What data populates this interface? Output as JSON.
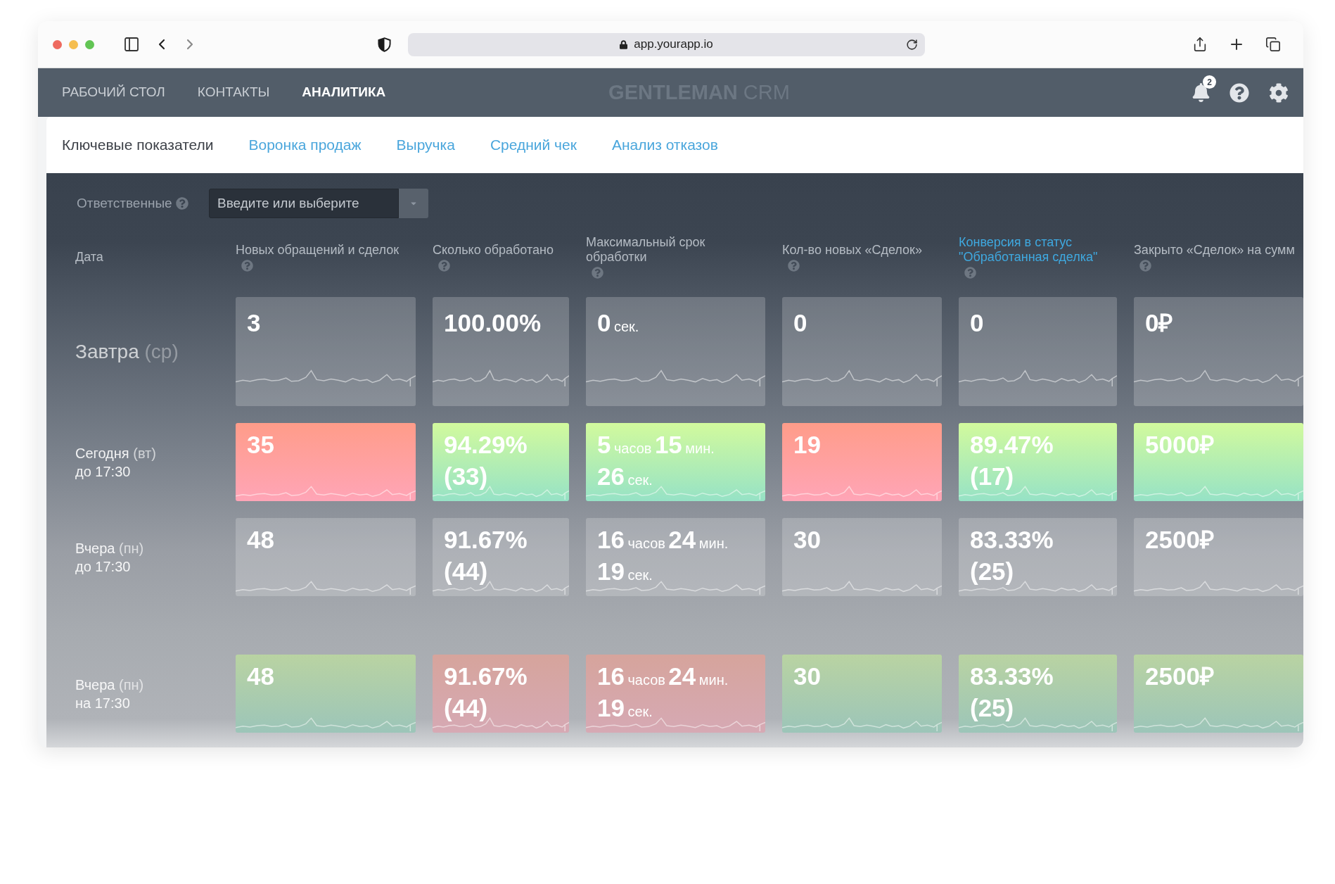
{
  "browser": {
    "url": "app.yourapp.io"
  },
  "nav": {
    "items": [
      {
        "label": "РАБОЧИЙ СТОЛ",
        "selected": false
      },
      {
        "label": "КОНТАКТЫ",
        "selected": false
      },
      {
        "label": "АНАЛИТИКА",
        "selected": true
      }
    ],
    "logo": {
      "name": "GENTLEMAN",
      "suffix": "CRM"
    },
    "notifications": {
      "badge": "2"
    }
  },
  "tabs": [
    {
      "label": "Ключевые показатели",
      "selected": true
    },
    {
      "label": "Воронка продаж",
      "selected": false
    },
    {
      "label": "Выручка",
      "selected": false
    },
    {
      "label": "Средний чек",
      "selected": false
    },
    {
      "label": "Анализ отказов",
      "selected": false
    }
  ],
  "filter": {
    "label": "Ответственные",
    "placeholder": "Введите или выберите"
  },
  "table": {
    "date_header": "Дата",
    "columns": [
      {
        "lines": [
          "Новых обращений и сделок"
        ],
        "highlighted": false
      },
      {
        "lines": [
          "Сколько обработано"
        ],
        "highlighted": false
      },
      {
        "lines": [
          "Максимальный срок",
          "обработки"
        ],
        "highlighted": false
      },
      {
        "lines": [
          "Кол-во новых «Сделок»"
        ],
        "highlighted": false
      },
      {
        "lines": [
          "Конверсия в статус",
          "\"Обработанная сделка\""
        ],
        "highlighted": true
      },
      {
        "lines": [
          "Закрыто «Сделок» на сумм"
        ],
        "highlighted": false
      }
    ],
    "rows": [
      {
        "kind": "headline",
        "faded": false,
        "day": "Завтра",
        "weekday": "(ср)",
        "cells": [
          {
            "kind": "neutral",
            "lines": [
              [
                {
                  "number": "3"
                }
              ]
            ]
          },
          {
            "kind": "neutral",
            "lines": [
              [
                {
                  "number": "100.00%"
                }
              ]
            ]
          },
          {
            "kind": "neutral",
            "lines": [
              [
                {
                  "number": "0",
                  "unit": "сек."
                }
              ]
            ]
          },
          {
            "kind": "neutral",
            "lines": [
              [
                {
                  "number": "0"
                }
              ]
            ]
          },
          {
            "kind": "neutral",
            "lines": [
              [
                {
                  "number": "0"
                }
              ]
            ]
          },
          {
            "kind": "neutral",
            "lines": [
              [
                {
                  "number": "0₽"
                }
              ]
            ]
          }
        ]
      },
      {
        "kind": "period",
        "faded": false,
        "day": "Сегодня",
        "weekday": "(вт)",
        "time": "до 17:30",
        "cells": [
          {
            "kind": "bad",
            "lines": [
              [
                {
                  "number": "35"
                }
              ]
            ]
          },
          {
            "kind": "good",
            "lines": [
              [
                {
                  "number": "94.29%"
                }
              ],
              [
                {
                  "number": "(33)"
                }
              ]
            ]
          },
          {
            "kind": "good",
            "lines": [
              [
                {
                  "number": "5",
                  "unit": "часов"
                },
                {
                  "number": "15",
                  "unit": "мин."
                }
              ],
              [
                {
                  "number": "26",
                  "unit": "сек."
                }
              ]
            ]
          },
          {
            "kind": "bad",
            "lines": [
              [
                {
                  "number": "19"
                }
              ]
            ]
          },
          {
            "kind": "good",
            "lines": [
              [
                {
                  "number": "89.47%"
                }
              ],
              [
                {
                  "number": "(17)"
                }
              ]
            ]
          },
          {
            "kind": "good",
            "lines": [
              [
                {
                  "number": "5000₽"
                }
              ]
            ]
          }
        ]
      },
      {
        "kind": "period",
        "faded": false,
        "day": "Вчера",
        "weekday": "(пн)",
        "time": "до 17:30",
        "cells": [
          {
            "kind": "neutral",
            "lines": [
              [
                {
                  "number": "48"
                }
              ]
            ]
          },
          {
            "kind": "neutral",
            "lines": [
              [
                {
                  "number": "91.67%"
                }
              ],
              [
                {
                  "number": "(44)"
                }
              ]
            ]
          },
          {
            "kind": "neutral",
            "lines": [
              [
                {
                  "number": "16",
                  "unit": "часов"
                },
                {
                  "number": "24",
                  "unit": "мин."
                }
              ],
              [
                {
                  "number": "19",
                  "unit": "сек."
                }
              ]
            ]
          },
          {
            "kind": "neutral",
            "lines": [
              [
                {
                  "number": "30"
                }
              ]
            ]
          },
          {
            "kind": "neutral",
            "lines": [
              [
                {
                  "number": "83.33%"
                }
              ],
              [
                {
                  "number": "(25)"
                }
              ]
            ]
          },
          {
            "kind": "neutral",
            "lines": [
              [
                {
                  "number": "2500₽"
                }
              ]
            ]
          }
        ]
      },
      {
        "kind": "period",
        "faded": true,
        "day": "Вчера",
        "weekday": "(пн)",
        "time": "на 17:30",
        "cells": [
          {
            "kind": "good",
            "lines": [
              [
                {
                  "number": "48"
                }
              ]
            ]
          },
          {
            "kind": "bad",
            "lines": [
              [
                {
                  "number": "91.67%"
                }
              ],
              [
                {
                  "number": "(44)"
                }
              ]
            ]
          },
          {
            "kind": "bad",
            "lines": [
              [
                {
                  "number": "16",
                  "unit": "часов"
                },
                {
                  "number": "24",
                  "unit": "мин."
                }
              ],
              [
                {
                  "number": "19",
                  "unit": "сек."
                }
              ]
            ]
          },
          {
            "kind": "good",
            "lines": [
              [
                {
                  "number": "30"
                }
              ]
            ]
          },
          {
            "kind": "good",
            "lines": [
              [
                {
                  "number": "83.33%"
                }
              ],
              [
                {
                  "number": "(25)"
                }
              ]
            ]
          },
          {
            "kind": "good",
            "lines": [
              [
                {
                  "number": "2500₽"
                }
              ]
            ]
          }
        ]
      }
    ]
  }
}
